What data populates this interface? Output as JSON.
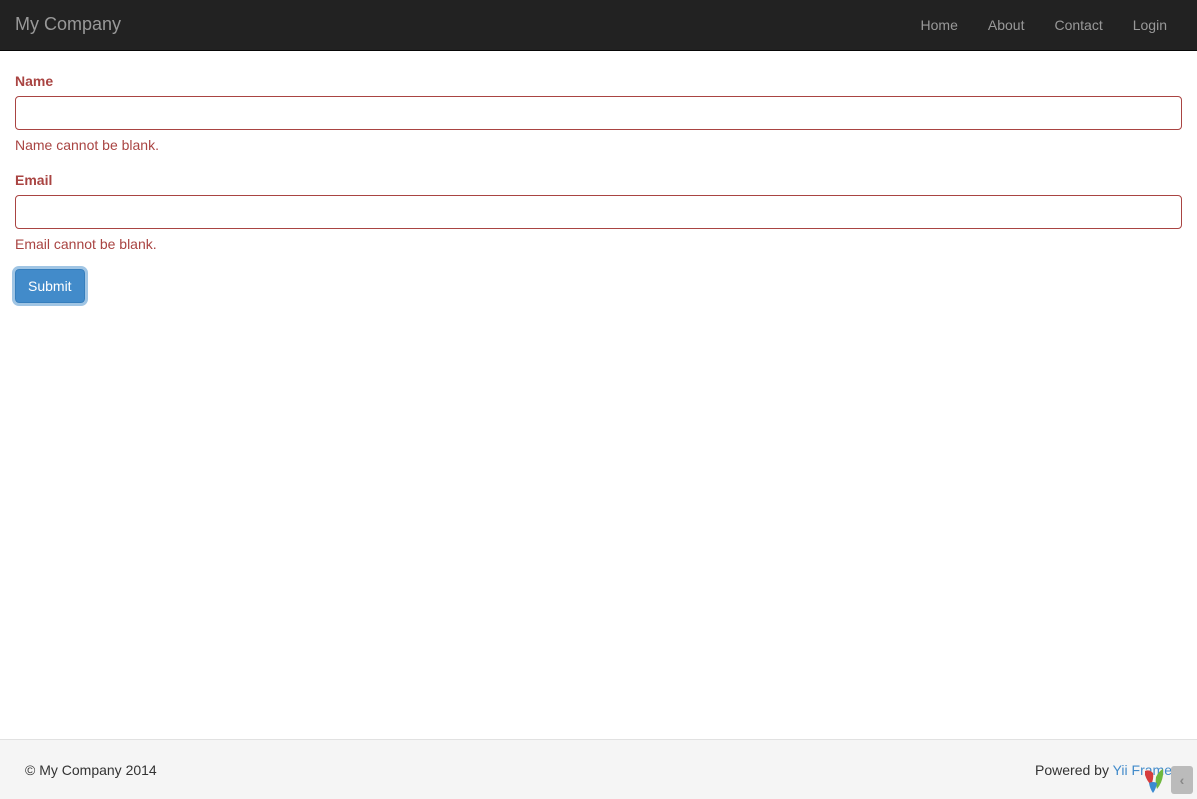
{
  "navbar": {
    "brand": "My Company",
    "links": [
      {
        "label": "Home"
      },
      {
        "label": "About"
      },
      {
        "label": "Contact"
      },
      {
        "label": "Login"
      }
    ]
  },
  "form": {
    "fields": [
      {
        "label": "Name",
        "value": "",
        "error": "Name cannot be blank."
      },
      {
        "label": "Email",
        "value": "",
        "error": "Email cannot be blank."
      }
    ],
    "submit_label": "Submit"
  },
  "footer": {
    "copyright": "© My Company 2014",
    "powered_by": "Powered by ",
    "framework_link": "Yii Frame"
  },
  "debug": {
    "toggle": "‹"
  }
}
